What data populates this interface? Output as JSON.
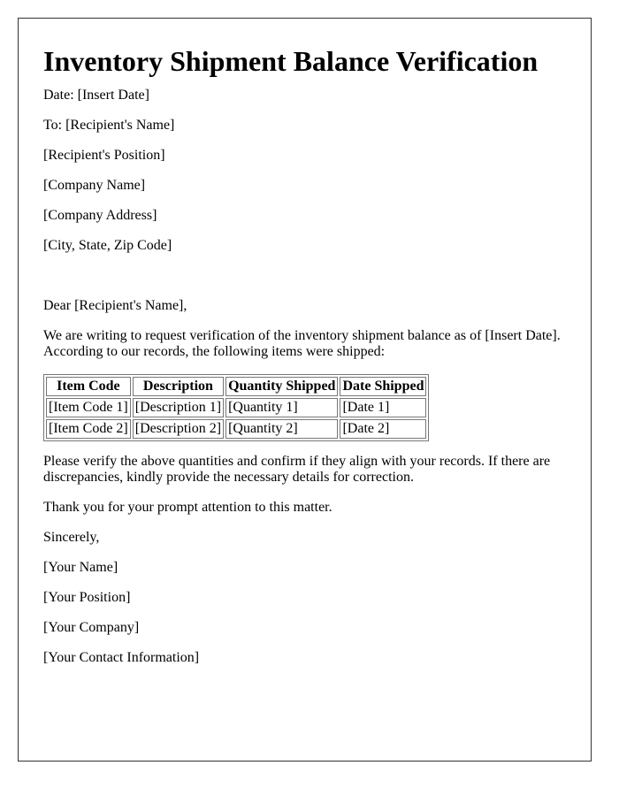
{
  "title": "Inventory Shipment Balance Verification",
  "header_lines": [
    "Date: [Insert Date]",
    "To: [Recipient's Name]",
    "[Recipient's Position]",
    "[Company Name]",
    "[Company Address]",
    "[City, State, Zip Code]"
  ],
  "salutation": "Dear [Recipient's Name],",
  "intro": "We are writing to request verification of the inventory shipment balance as of [Insert Date]. According to our records, the following items were shipped:",
  "table": {
    "headers": [
      "Item Code",
      "Description",
      "Quantity Shipped",
      "Date Shipped"
    ],
    "rows": [
      [
        "[Item Code 1]",
        "[Description 1]",
        "[Quantity 1]",
        "[Date 1]"
      ],
      [
        "[Item Code 2]",
        "[Description 2]",
        "[Quantity 2]",
        "[Date 2]"
      ]
    ]
  },
  "request": "Please verify the above quantities and confirm if they align with your records. If there are discrepancies, kindly provide the necessary details for correction.",
  "thanks": "Thank you for your prompt attention to this matter.",
  "closing": "Sincerely,",
  "signature_lines": [
    "[Your Name]",
    "[Your Position]",
    "[Your Company]",
    "[Your Contact Information]"
  ]
}
